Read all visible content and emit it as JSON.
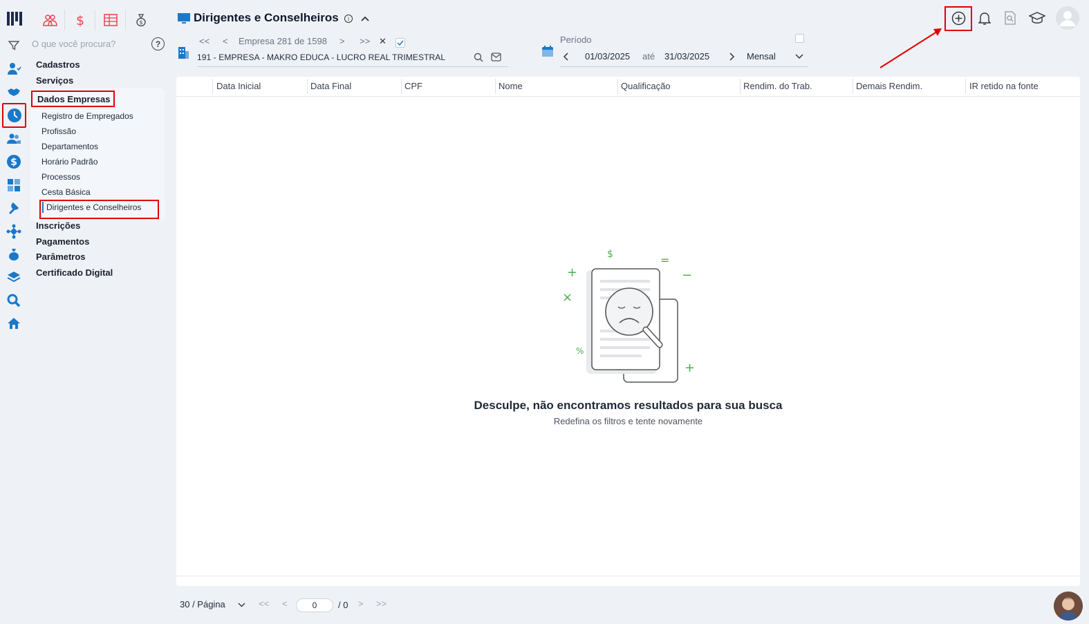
{
  "header": {
    "title": "Dirigentes e Conselheiros",
    "info_glyph": "i"
  },
  "search": {
    "placeholder": "O que você procura?",
    "help_glyph": "?"
  },
  "menu": {
    "items": [
      {
        "label": "Cadastros"
      },
      {
        "label": "Serviços"
      },
      {
        "label": "Dados Empresas"
      },
      {
        "label": "Inscrições"
      },
      {
        "label": "Pagamentos"
      },
      {
        "label": "Parâmetros"
      },
      {
        "label": "Certificado Digital"
      }
    ],
    "sub_items": [
      {
        "label": "Registro de Empregados"
      },
      {
        "label": "Profissão"
      },
      {
        "label": "Departamentos"
      },
      {
        "label": "Horário Padrão"
      },
      {
        "label": "Processos"
      },
      {
        "label": "Cesta Básica"
      },
      {
        "label": "Dirigentes e Conselheiros"
      }
    ]
  },
  "company_nav": {
    "first": "<<",
    "prev": "<",
    "position_text": "Empresa 281 de 1598",
    "next": ">",
    "last": ">>",
    "clear": "✕",
    "company_name": "191 - EMPRESA - MAKRO EDUCA - LUCRO REAL TRIMESTRAL"
  },
  "period": {
    "label": "Período",
    "start": "01/03/2025",
    "separator": "até",
    "end": "31/03/2025",
    "frequency": "Mensal"
  },
  "table": {
    "columns": [
      "Data Inicial",
      "Data Final",
      "CPF",
      "Nome",
      "Qualificação",
      "Rendim. do Trab.",
      "Demais Rendim.",
      "IR retido na fonte"
    ],
    "rows": []
  },
  "empty_state": {
    "title": "Desculpe, não encontramos resultados para sua busca",
    "subtitle": "Redefina os filtros e tente novamente",
    "symbols": {
      "dollar": "$",
      "equals": "=",
      "plus": "+",
      "minus": "−",
      "times": "×",
      "percent": "%"
    }
  },
  "pagination": {
    "per_page": "30 / Página",
    "current_page": "0",
    "total": "/ 0",
    "first": "<<",
    "prev": "<",
    "next": ">",
    "last": ">>"
  },
  "colors": {
    "accent": "#1b78c9",
    "highlight": "#e00000",
    "module_icons": "#e8414b",
    "empty_accent": "#4caf50"
  }
}
